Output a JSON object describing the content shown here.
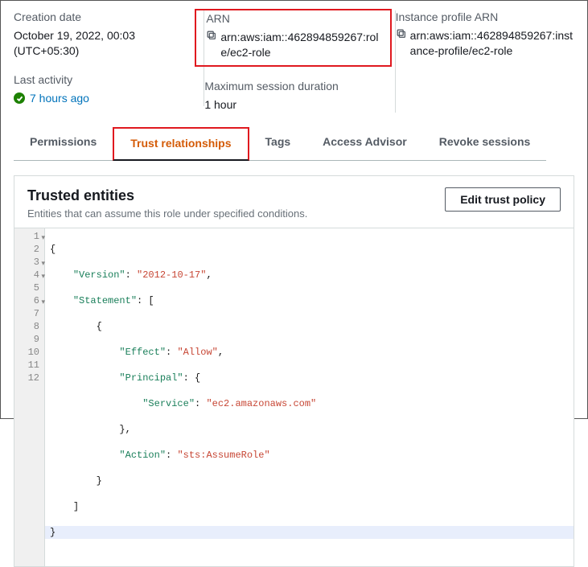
{
  "info": {
    "creation": {
      "label": "Creation date",
      "value": "October 19, 2022, 00:03 (UTC+05:30)"
    },
    "arn": {
      "label": "ARN",
      "value": "arn:aws:iam::462894859267:role/ec2-role"
    },
    "profile": {
      "label": "Instance profile ARN",
      "value": "arn:aws:iam::462894859267:instance-profile/ec2-role"
    },
    "activity": {
      "label": "Last activity",
      "value": "7 hours ago"
    },
    "session": {
      "label": "Maximum session duration",
      "value": "1 hour"
    }
  },
  "tabs": {
    "permissions": "Permissions",
    "trust": "Trust relationships",
    "tags": "Tags",
    "advisor": "Access Advisor",
    "revoke": "Revoke sessions"
  },
  "panel": {
    "title": "Trusted entities",
    "sub": "Entities that can assume this role under specified conditions.",
    "button": "Edit trust policy"
  },
  "policy": {
    "version_key": "\"Version\"",
    "version_val": "\"2012-10-17\"",
    "statement_key": "\"Statement\"",
    "effect_key": "\"Effect\"",
    "effect_val": "\"Allow\"",
    "principal_key": "\"Principal\"",
    "service_key": "\"Service\"",
    "service_val": "\"ec2.amazonaws.com\"",
    "action_key": "\"Action\"",
    "action_val": "\"sts:AssumeRole\""
  },
  "linenums": [
    "1",
    "2",
    "3",
    "4",
    "5",
    "6",
    "7",
    "8",
    "9",
    "10",
    "11",
    "12"
  ]
}
